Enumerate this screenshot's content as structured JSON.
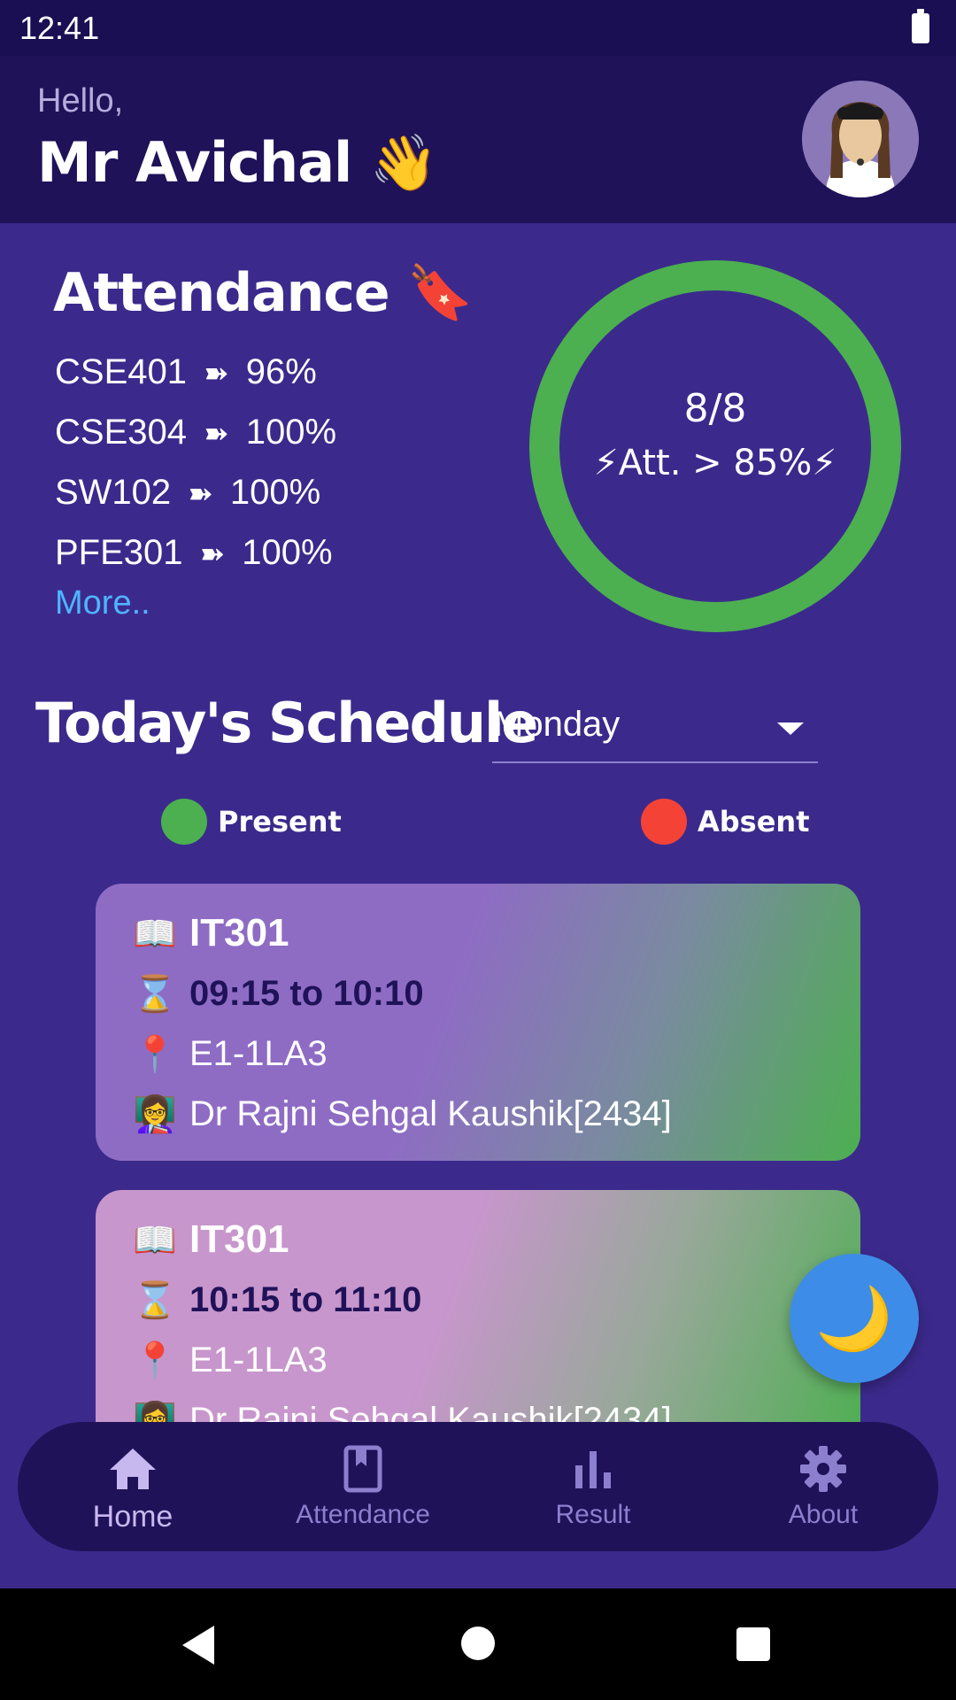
{
  "status_bar": {
    "time": "12:41",
    "battery_icon": "battery-full-icon"
  },
  "header": {
    "greeting": "Hello,",
    "user_name": "Mr Avichal 👋",
    "avatar_icon": "avatar-icon"
  },
  "attendance": {
    "title": "Attendance 🔖",
    "arrow_glyph": "➽",
    "courses": [
      {
        "code": "CSE401",
        "percent": "96%"
      },
      {
        "code": "CSE304",
        "percent": "100%"
      },
      {
        "code": "SW102",
        "percent": "100%"
      },
      {
        "code": "PFE301",
        "percent": "100%"
      }
    ],
    "more_label": "More..",
    "summary_count": "8/8",
    "summary_caption": "⚡Att. > 85%⚡",
    "ring_color": "#4caf50"
  },
  "schedule": {
    "title": "Today's Schedule",
    "selected_day": "Monday",
    "legend": [
      {
        "label": "Present",
        "color": "#4caf50"
      },
      {
        "label": "Absent",
        "color": "#f44336"
      }
    ],
    "classes": [
      {
        "code_icon": "📖",
        "code": "IT301",
        "time_icon": "⌛",
        "time": "09:15  to 10:10",
        "room_icon": "📍",
        "room": "E1-1LA3",
        "teacher_icon": "👩‍🏫",
        "teacher": "Dr Rajni Sehgal Kaushik[2434]"
      },
      {
        "code_icon": "📖",
        "code": "IT301",
        "time_icon": "⌛",
        "time": "10:15  to 11:10",
        "room_icon": "📍",
        "room": "E1-1LA3",
        "teacher_icon": "👩‍🏫",
        "teacher": "Dr Rajni Sehgal Kaushik[2434]"
      }
    ]
  },
  "fab": {
    "icon": "moon-icon",
    "glyph": "🌙"
  },
  "bottom_nav": {
    "items": [
      {
        "label": "Home",
        "icon": "home-icon",
        "active": true
      },
      {
        "label": "Attendance",
        "icon": "book-icon",
        "active": false
      },
      {
        "label": "Result",
        "icon": "bar-chart-icon",
        "active": false
      },
      {
        "label": "About",
        "icon": "gear-icon",
        "active": false
      }
    ]
  },
  "colors": {
    "background": "#3b2a8c",
    "header": "#1f1259",
    "accent_link": "#4fb4ff",
    "fab": "#3d8de8"
  }
}
